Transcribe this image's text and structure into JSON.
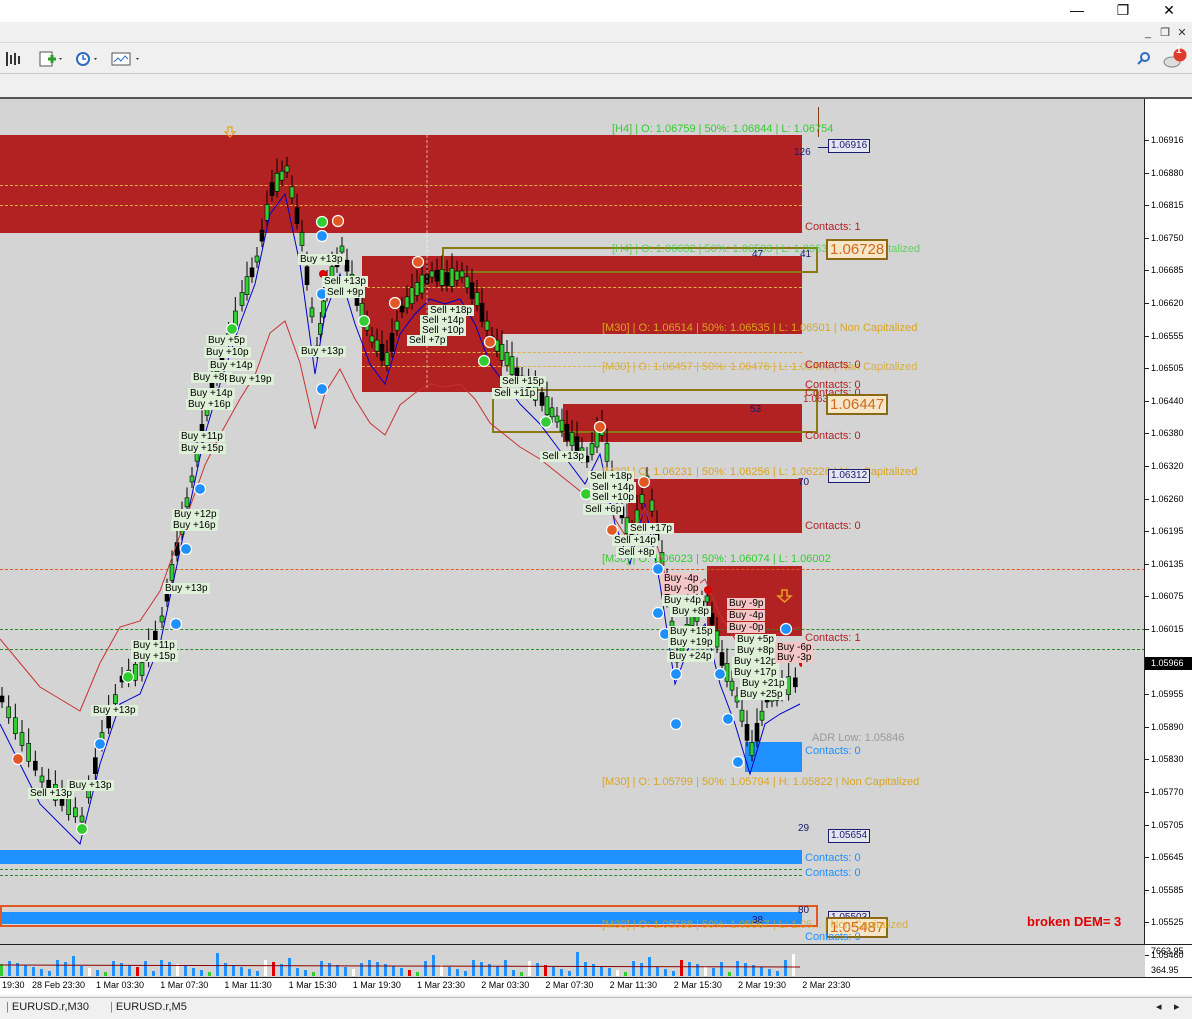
{
  "window": {
    "min": "—",
    "max": "❐",
    "close": "✕",
    "mdi_min": "_",
    "mdi_restore": "❐",
    "mdi_close": "✕"
  },
  "toolbar": {
    "notif_count": "1"
  },
  "zones": [
    {
      "info": "[H4] | O: 1.06759 | 50%: 1.06844 | L: 1.06754",
      "contacts": "Contacts: 1",
      "count": "126",
      "price_box": "1.06916"
    },
    {
      "info": "[H4] | O: 1.06632 | 50%: 1.06583 | L: 1.06637 | Non Capitalized",
      "count": "47",
      "count2": "41",
      "price_box": "1.06728"
    },
    {
      "info": "[M30] | O: 1.06514 | 50%: 1.06535 | L: 1.06501 | Non Capitalized"
    },
    {
      "info": "[M30] | O: 1.06457 | 50%: 1.06476 | L: 1.06466 | Non Capitalized",
      "contacts": "Contacts: 0"
    },
    {
      "contacts": "Contacts: 0",
      "contacts2": "Contacts: 0",
      "price_small": "1.06371",
      "price_box": "1.06447",
      "count": "53"
    },
    {
      "contacts": "Contacts: 0"
    },
    {
      "info": "[M30] | O: 1.06231 | 50%: 1.06256 | L: 1.06226 | Non Capitalized",
      "count": "70",
      "price_box": "1.06312",
      "contacts": "Contacts: 0"
    },
    {
      "info": "[M30] | O: 1.06023 | 50%: 1.06074 | L: 1.06002"
    },
    {
      "contacts": "Contacts: 1"
    },
    {
      "adr": "ADR Low: 1.05846",
      "contacts": "Contacts: 0"
    },
    {
      "info": "[M30] | O: 1.05799 | 50%: 1.05794 | H: 1.05822 | Non Capitalized"
    },
    {
      "count": "29",
      "price_box": "1.05654"
    },
    {
      "contacts": "Contacts: 0",
      "contacts2": "Contacts: 0"
    },
    {
      "count": "80",
      "count2": "38",
      "price_box": "1.05503",
      "price_box2": "1.05487",
      "info": "[M30] | O: 1.05588 | 50%: 1.05567 | L: 1.05... | Non Capitalized",
      "contacts": "Contacts: 0"
    }
  ],
  "broken_dem": "broken DEM= 3",
  "price_axis": [
    "1.06916",
    "1.06880",
    "1.06815",
    "1.06750",
    "1.06685",
    "1.06620",
    "1.06555",
    "1.06505",
    "1.06440",
    "1.06380",
    "1.06320",
    "1.06260",
    "1.06195",
    "1.06135",
    "1.06075",
    "1.06015",
    "1.05966",
    "1.05955",
    "1.05890",
    "1.05830",
    "1.05770",
    "1.05705",
    "1.05645",
    "1.05585",
    "1.05525",
    "1.05460"
  ],
  "current_price": "1.05966",
  "volume_axis": [
    "7663.95",
    "364.95"
  ],
  "time_axis": [
    "19:30",
    "28 Feb 23:30",
    "1 Mar 03:30",
    "1 Mar 07:30",
    "1 Mar 11:30",
    "1 Mar 15:30",
    "1 Mar 19:30",
    "1 Mar 23:30",
    "2 Mar 03:30",
    "2 Mar 07:30",
    "2 Mar 11:30",
    "2 Mar 15:30",
    "2 Mar 19:30",
    "2 Mar 23:30"
  ],
  "tabs": [
    "EURUSD.r,M30",
    "EURUSD.r,M5"
  ],
  "trade_tags": [
    {
      "text": "Buy +13p",
      "red": false
    },
    {
      "text": "Sell +18p",
      "red": false
    },
    {
      "text": "Sell +13p",
      "red": false
    },
    {
      "text": "Sell +9p",
      "red": false
    },
    {
      "text": "Buy +13p",
      "red": false
    },
    {
      "text": "Buy +5p",
      "red": false
    },
    {
      "text": "Buy +10p",
      "red": false
    },
    {
      "text": "Buy +14p",
      "red": false
    },
    {
      "text": "Buy +8p",
      "red": false
    },
    {
      "text": "Buy +19p",
      "red": false
    },
    {
      "text": "Buy +14p",
      "red": false
    },
    {
      "text": "Buy +16p",
      "red": false
    },
    {
      "text": "Buy +11p",
      "red": false
    },
    {
      "text": "Buy +15p",
      "red": false
    },
    {
      "text": "Buy +12p",
      "red": false
    },
    {
      "text": "Buy +16p",
      "red": false
    },
    {
      "text": "Buy +13p",
      "red": false
    },
    {
      "text": "Buy +11p",
      "red": false
    },
    {
      "text": "Buy +15p",
      "red": false
    },
    {
      "text": "Buy +13p",
      "red": false
    },
    {
      "text": "Sell +13p",
      "red": false
    },
    {
      "text": "Buy +13p",
      "red": false
    },
    {
      "text": "Sell +18p",
      "red": false
    },
    {
      "text": "Sell +14p",
      "red": false
    },
    {
      "text": "Sell +10p",
      "red": false
    },
    {
      "text": "Sell +7p",
      "red": false
    },
    {
      "text": "Sell +15p",
      "red": false
    },
    {
      "text": "Sell +11p",
      "red": false
    },
    {
      "text": "Sell +13p",
      "red": false
    },
    {
      "text": "Sell +18p",
      "red": false
    },
    {
      "text": "Sell +14p",
      "red": false
    },
    {
      "text": "Sell +10p",
      "red": false
    },
    {
      "text": "Sell +6p",
      "red": false
    },
    {
      "text": "Sell +17p",
      "red": false
    },
    {
      "text": "Sell +14p",
      "red": false
    },
    {
      "text": "Sell +8p",
      "red": false
    },
    {
      "text": "Buy -4p",
      "red": true
    },
    {
      "text": "Buy -0p",
      "red": true
    },
    {
      "text": "Buy +4p",
      "red": false
    },
    {
      "text": "Buy +8p",
      "red": false
    },
    {
      "text": "Buy +15p",
      "red": false
    },
    {
      "text": "Buy +19p",
      "red": false
    },
    {
      "text": "Buy +24p",
      "red": false
    },
    {
      "text": "Buy -9p",
      "red": true
    },
    {
      "text": "Buy -4p",
      "red": true
    },
    {
      "text": "Buy -0p",
      "red": true
    },
    {
      "text": "Buy +5p",
      "red": false
    },
    {
      "text": "Buy +8p",
      "red": false
    },
    {
      "text": "Buy +12p",
      "red": false
    },
    {
      "text": "Buy +17p",
      "red": false
    },
    {
      "text": "Buy +21p",
      "red": false
    },
    {
      "text": "Buy +25p",
      "red": false
    },
    {
      "text": "Buy -6p",
      "red": true
    },
    {
      "text": "Buy -3p",
      "red": true
    }
  ]
}
